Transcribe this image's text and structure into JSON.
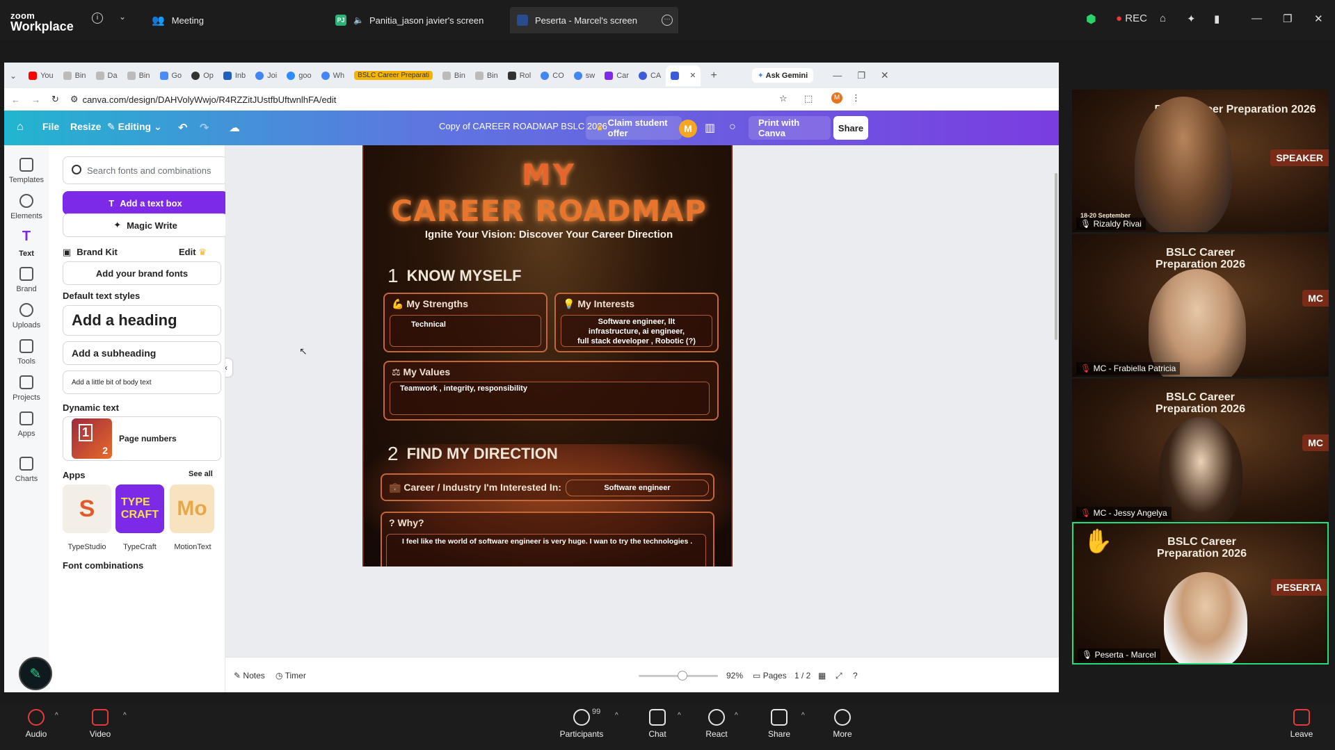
{
  "zoom": {
    "logo_small": "zoom",
    "logo_big": "Workplace",
    "tabs": [
      {
        "label": "Meeting"
      },
      {
        "label": "Panitia_jason javier's screen",
        "badge": "PJ"
      },
      {
        "label": "Peserta - Marcel's screen"
      }
    ],
    "rec_label": "REC"
  },
  "browser": {
    "tabs": [
      "You",
      "Bin",
      "Da",
      "Bin",
      "Go",
      "Op",
      "Inb",
      "Joi",
      "goo",
      "Wh",
      "BSLC Career Preparati",
      "Bin",
      "Bin",
      "Rol",
      "CO",
      "sw",
      "Car",
      "CA"
    ],
    "ask_gemini": "Ask Gemini",
    "url": "canva.com/design/DAHVolyWwjo/R4RZZitJUstfbUftwnlhFA/edit"
  },
  "canva": {
    "header": {
      "file": "File",
      "resize": "Resize",
      "editing": "Editing",
      "doc_title": "Copy of CAREER ROADMAP BSLC 2026",
      "claim": "Claim student offer",
      "avatar": "M",
      "print": "Print with Canva",
      "share": "Share"
    },
    "rail": [
      "Templates",
      "Elements",
      "Text",
      "Brand",
      "Uploads",
      "Tools",
      "Projects",
      "Apps",
      "Charts"
    ],
    "panel": {
      "search_placeholder": "Search fonts and combinations",
      "add_text_box": "Add a text box",
      "magic_write": "Magic Write",
      "brand_kit": "Brand Kit",
      "edit": "Edit",
      "add_brand_fonts": "Add your brand fonts",
      "default_styles": "Default text styles",
      "heading": "Add a heading",
      "subheading": "Add a subheading",
      "body": "Add a little bit of body text",
      "dynamic_text": "Dynamic text",
      "page_numbers": "Page numbers",
      "page_icon_1": "1",
      "page_icon_2": "2",
      "apps": "Apps",
      "see_all": "See all",
      "app_list": [
        "TypeStudio",
        "TypeCraft",
        "MotionText"
      ],
      "font_combinations": "Font combinations"
    },
    "design": {
      "title1": "MY",
      "title2": "CAREER ROADMAP",
      "subtitle": "Ignite Your Vision: Discover Your Career Direction",
      "sec1_num": "1",
      "sec1": "KNOW MYSELF",
      "strengths_title": "My Strengths",
      "strengths": "Technical",
      "interests_title": "My Interests",
      "interests_l1": "Software engineer, llt",
      "interests_l2": "infrastructure, ai engineer,",
      "interests_l3": "full stack developer , Robotic (?)",
      "values_title": "My Values",
      "values": "Teamwork ,  integrity, responsibility",
      "sec2_num": "2",
      "sec2": "FIND MY DIRECTION",
      "career_label": "Career / Industry I'm Interested In:",
      "career_value": "Software engineer",
      "why_label": "Why?",
      "why_value": "I feel like  the world of software engineer is very huge. I wan to try the technologies ."
    },
    "bottom": {
      "notes": "Notes",
      "timer": "Timer",
      "zoom_pct": "92%",
      "pages": "Pages",
      "page_count": "1 / 2",
      "zoom_level": 0.55
    }
  },
  "participants": [
    {
      "name": "Rizaldy Rivai",
      "role": "SPEAKER",
      "logo": "BSLC Career Preparation 2026",
      "date": "18-20 September"
    },
    {
      "name": "MC - Frabiella Patricia",
      "role": "MC",
      "logo": "BSLC Career Preparation 2026"
    },
    {
      "name": "MC - Jessy Angelya",
      "role": "MC",
      "logo": "BSLC Career Preparation 2026"
    },
    {
      "name": "Peserta - Marcel",
      "role": "PESERTA",
      "logo": "BSLC Career Preparation 2026"
    }
  ],
  "zoom_bottom": {
    "audio": "Audio",
    "video": "Video",
    "participants": "Participants",
    "participant_count": "99",
    "chat": "Chat",
    "react": "React",
    "share": "Share",
    "more": "More",
    "leave": "Leave"
  }
}
